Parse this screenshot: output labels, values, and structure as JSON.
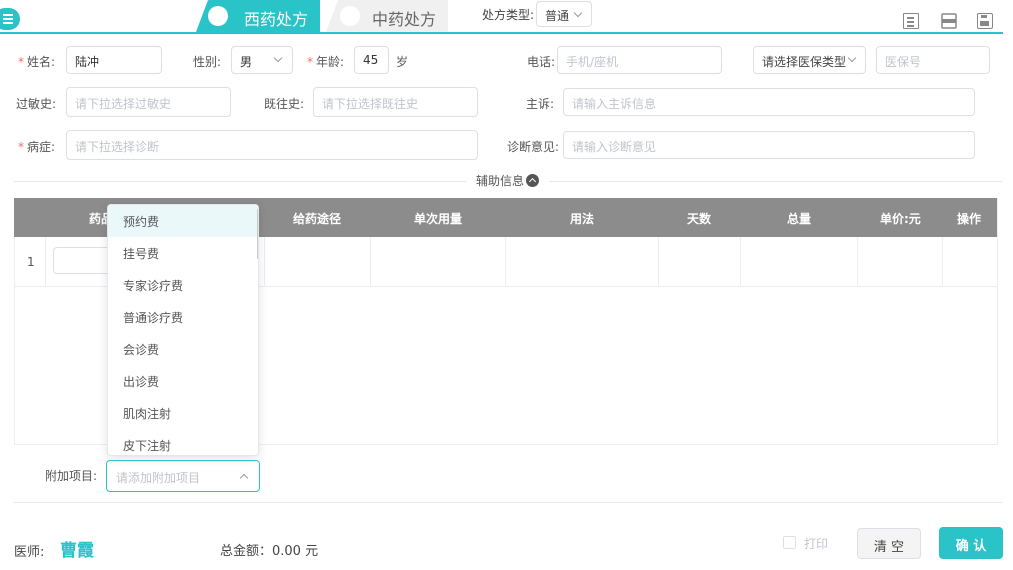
{
  "header": {
    "tabs": [
      {
        "label": "西药处方",
        "active": true
      },
      {
        "label": "中药处方",
        "active": false
      }
    ],
    "rx_type_label": "处方类型:",
    "rx_type_value": "普通"
  },
  "form": {
    "name_label": "姓名:",
    "name_value": "陆冲",
    "gender_label": "性别:",
    "gender_value": "男",
    "age_label": "年龄:",
    "age_value": "45",
    "age_unit": "岁",
    "phone_label": "电话:",
    "phone_placeholder": "手机/座机",
    "insurance_type_placeholder": "请选择医保类型",
    "insurance_no_placeholder": "医保号",
    "allergy_label": "过敏史:",
    "allergy_placeholder": "请下拉选择过敏史",
    "history_label": "既往史:",
    "history_placeholder": "请下拉选择既往史",
    "complaint_label": "主诉:",
    "complaint_placeholder": "请输入主诉信息",
    "disease_label": "病症:",
    "disease_placeholder": "请下拉选择诊断",
    "opinion_label": "诊断意见:",
    "opinion_placeholder": "请输入诊断意见",
    "aux_info": "辅助信息"
  },
  "table": {
    "columns": [
      "药品",
      "给药途径",
      "单次用量",
      "用法",
      "天数",
      "总量",
      "单价:元",
      "操作"
    ],
    "rows": [
      {
        "index": "1"
      }
    ]
  },
  "dropdown": {
    "items": [
      "预约费",
      "挂号费",
      "专家诊疗费",
      "普通诊疗费",
      "会诊费",
      "出诊费",
      "肌肉注射",
      "皮下注射"
    ],
    "selected_index": 0
  },
  "extra": {
    "label": "附加项目:",
    "placeholder": "请添加附加项目"
  },
  "footer": {
    "doctor_label": "医师:",
    "doctor_name": "曹霞",
    "total_label": "总金额：0.00 元",
    "print_label": "打印",
    "clear_label": "清 空",
    "confirm_label": "确 认"
  },
  "colors": {
    "accent": "#29c3c8",
    "header_gray": "#8c8c8c",
    "required": "#f56c6c"
  },
  "icons": [
    "menu-icon",
    "list-icon",
    "print-icon",
    "save-icon",
    "chevron-up-icon",
    "chevron-down-icon"
  ]
}
